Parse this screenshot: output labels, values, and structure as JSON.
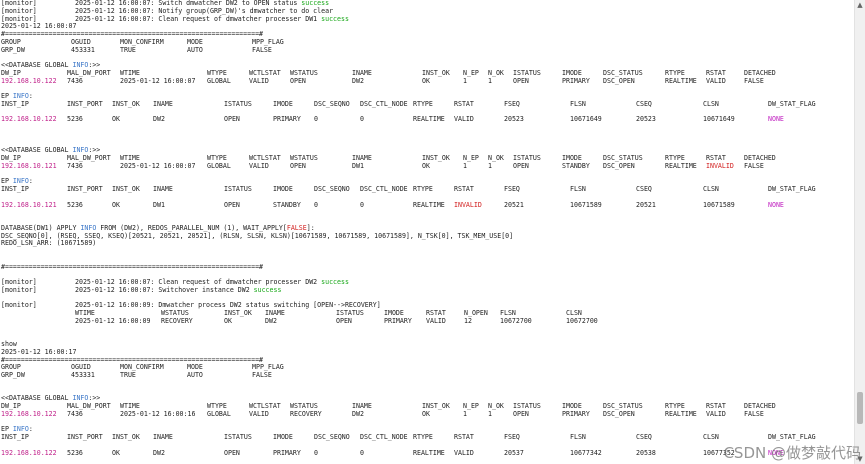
{
  "watermark": "CSDN @做梦敲代码",
  "colors": {
    "ip": "#c0208a",
    "keyword": "#3a76c8",
    "success": "#1aa81a",
    "invalid": "#d21f1f",
    "none": "#c020c0"
  },
  "lines": [
    [
      {
        "t": "[monitor]"
      },
      {
        "t": "2025-01-12 16:00:07: Switch dmwatcher DW2 to OPEN status "
      },
      {
        "t": "success",
        "cls": "ok"
      }
    ],
    [
      {
        "t": "[monitor]"
      },
      {
        "t": "2025-01-12 16:00:07: Notify group(GRP_DW)'s dmwatcher to do clear"
      }
    ],
    [
      {
        "t": "[monitor]"
      },
      {
        "t": "2025-01-12 16:00:07: Clean request of dmwatcher processer DW1 "
      },
      {
        "t": "success",
        "cls": "ok"
      }
    ],
    [
      {
        "t": "2025-01-12 16:00:07"
      }
    ],
    [
      {
        "t": "#================================================================#"
      }
    ],
    [
      {
        "t": "GROUP"
      },
      {
        "t": "OGUID"
      },
      {
        "t": "MON_CONFIRM"
      },
      {
        "t": "MODE"
      },
      {
        "t": "MPP_FLAG"
      }
    ],
    [
      {
        "t": "GRP_DW"
      },
      {
        "t": "453331"
      },
      {
        "t": "TRUE"
      },
      {
        "t": "AUTO"
      },
      {
        "t": "FALSE"
      }
    ],
    [],
    [
      {
        "t": "<<DATABASE GLOBAL "
      },
      {
        "t": "INFO",
        "cls": "kw"
      },
      {
        "t": ":>>"
      }
    ],
    [
      {
        "t": "DW_IP"
      },
      {
        "t": "MAL_DW_PORT"
      },
      {
        "t": "WTIME"
      },
      {
        "t": "WTYPE"
      },
      {
        "t": "WCTLSTAT"
      },
      {
        "t": "WSTATUS"
      },
      {
        "t": "INAME"
      },
      {
        "t": "INST_OK"
      },
      {
        "t": "N_EP"
      },
      {
        "t": "N_OK"
      },
      {
        "t": "ISTATUS"
      },
      {
        "t": "IMODE"
      },
      {
        "t": "DSC_STATUS"
      },
      {
        "t": "RTYPE"
      },
      {
        "t": "RSTAT"
      },
      {
        "t": "DETACHED"
      }
    ],
    [
      {
        "t": "192.168.10.122",
        "cls": "ip"
      },
      {
        "t": "7436"
      },
      {
        "t": "2025-01-12 16:00:07"
      },
      {
        "t": "GLOBAL"
      },
      {
        "t": "VALID"
      },
      {
        "t": "OPEN"
      },
      {
        "t": "DW2"
      },
      {
        "t": "OK"
      },
      {
        "t": "1"
      },
      {
        "t": "1"
      },
      {
        "t": "OPEN"
      },
      {
        "t": "PRIMARY"
      },
      {
        "t": "DSC_OPEN"
      },
      {
        "t": "REALTIME"
      },
      {
        "t": "VALID"
      },
      {
        "t": "FALSE"
      }
    ],
    [],
    [
      {
        "t": "EP "
      },
      {
        "t": "INFO",
        "cls": "kw"
      },
      {
        "t": ":"
      }
    ],
    [
      {
        "t": "INST_IP"
      },
      {
        "t": "INST_PORT"
      },
      {
        "t": "INST_OK"
      },
      {
        "t": "INAME"
      },
      {
        "t": "ISTATUS"
      },
      {
        "t": "IMODE"
      },
      {
        "t": "DSC_SEQNO"
      },
      {
        "t": "DSC_CTL_NODE"
      },
      {
        "t": "RTYPE"
      },
      {
        "t": "RSTAT"
      },
      {
        "t": "FSEQ"
      },
      {
        "t": "FLSN"
      },
      {
        "t": "CSEQ"
      },
      {
        "t": "CLSN"
      },
      {
        "t": "DW_STAT_FLAG"
      }
    ],
    [],
    [
      {
        "t": "192.168.10.122",
        "cls": "ip"
      },
      {
        "t": "5236"
      },
      {
        "t": "OK"
      },
      {
        "t": "DW2"
      },
      {
        "t": "OPEN"
      },
      {
        "t": "PRIMARY"
      },
      {
        "t": "0"
      },
      {
        "t": "0"
      },
      {
        "t": "REALTIME"
      },
      {
        "t": "VALID"
      },
      {
        "t": "20523"
      },
      {
        "t": "10671649"
      },
      {
        "t": "20523"
      },
      {
        "t": "10671649"
      },
      {
        "t": "NONE",
        "cls": "none"
      }
    ],
    [],
    [],
    [],
    [
      {
        "t": "<<DATABASE GLOBAL "
      },
      {
        "t": "INFO",
        "cls": "kw"
      },
      {
        "t": ":>>"
      }
    ],
    [
      {
        "t": "DW_IP"
      },
      {
        "t": "MAL_DW_PORT"
      },
      {
        "t": "WTIME"
      },
      {
        "t": "WTYPE"
      },
      {
        "t": "WCTLSTAT"
      },
      {
        "t": "WSTATUS"
      },
      {
        "t": "INAME"
      },
      {
        "t": "INST_OK"
      },
      {
        "t": "N_EP"
      },
      {
        "t": "N_OK"
      },
      {
        "t": "ISTATUS"
      },
      {
        "t": "IMODE"
      },
      {
        "t": "DSC_STATUS"
      },
      {
        "t": "RTYPE"
      },
      {
        "t": "RSTAT"
      },
      {
        "t": "DETACHED"
      }
    ],
    [
      {
        "t": "192.168.10.121",
        "cls": "ip"
      },
      {
        "t": "7436"
      },
      {
        "t": "2025-01-12 16:00:07"
      },
      {
        "t": "GLOBAL"
      },
      {
        "t": "VALID"
      },
      {
        "t": "OPEN"
      },
      {
        "t": "DW1"
      },
      {
        "t": "OK"
      },
      {
        "t": "1"
      },
      {
        "t": "1"
      },
      {
        "t": "OPEN"
      },
      {
        "t": "STANDBY"
      },
      {
        "t": "DSC_OPEN"
      },
      {
        "t": "REALTIME"
      },
      {
        "t": "INVALID",
        "cls": "bad"
      },
      {
        "t": "FALSE"
      }
    ],
    [],
    [
      {
        "t": "EP "
      },
      {
        "t": "INFO",
        "cls": "kw"
      },
      {
        "t": ":"
      }
    ],
    [
      {
        "t": "INST_IP"
      },
      {
        "t": "INST_PORT"
      },
      {
        "t": "INST_OK"
      },
      {
        "t": "INAME"
      },
      {
        "t": "ISTATUS"
      },
      {
        "t": "IMODE"
      },
      {
        "t": "DSC_SEQNO"
      },
      {
        "t": "DSC_CTL_NODE"
      },
      {
        "t": "RTYPE"
      },
      {
        "t": "RSTAT"
      },
      {
        "t": "FSEQ"
      },
      {
        "t": "FLSN"
      },
      {
        "t": "CSEQ"
      },
      {
        "t": "CLSN"
      },
      {
        "t": "DW_STAT_FLAG"
      }
    ],
    [],
    [
      {
        "t": "192.168.10.121",
        "cls": "ip"
      },
      {
        "t": "5236"
      },
      {
        "t": "OK"
      },
      {
        "t": "DW1"
      },
      {
        "t": "OPEN"
      },
      {
        "t": "STANDBY"
      },
      {
        "t": "0"
      },
      {
        "t": "0"
      },
      {
        "t": "REALTIME"
      },
      {
        "t": "INVALID",
        "cls": "bad"
      },
      {
        "t": "20521"
      },
      {
        "t": "10671589"
      },
      {
        "t": "20521"
      },
      {
        "t": "10671589"
      },
      {
        "t": "NONE",
        "cls": "none"
      }
    ],
    [],
    [],
    [
      {
        "t": "DATABASE(DW1) APPLY "
      },
      {
        "t": "INFO",
        "cls": "kw"
      },
      {
        "t": " FROM (DW2), REDOS_PARALLEL_NUM (1), WAIT_APPLY["
      },
      {
        "t": "FALSE",
        "cls": "bad"
      },
      {
        "t": "]:"
      }
    ],
    [
      {
        "t": "DSC_SEQNO[0], (RSEQ, SSEQ, KSEQ)[20521, 20521, 20521], (RLSN, SLSN, KLSN)[10671589, 10671589, 10671589], N_TSK[0], TSK_MEM_USE[0]"
      }
    ],
    [
      {
        "t": "REDO_LSN_ARR: (10671589)"
      }
    ],
    [],
    [],
    [
      {
        "t": "#================================================================#"
      }
    ],
    [],
    [
      {
        "t": "[monitor]"
      },
      {
        "t": "2025-01-12 16:00:07: Clean request of dmwatcher processer DW2 "
      },
      {
        "t": "success",
        "cls": "ok"
      }
    ],
    [
      {
        "t": "[monitor]"
      },
      {
        "t": "2025-01-12 16:00:07: Switchover instance DW2 "
      },
      {
        "t": "success",
        "cls": "ok"
      }
    ],
    [],
    [
      {
        "t": "[monitor]"
      },
      {
        "t": "2025-01-12 16:00:09: Dmwatcher process DW2 status switching [OPEN-->RECOVERY]"
      }
    ],
    [
      {
        "t": "WTIME"
      },
      {
        "t": "WSTATUS"
      },
      {
        "t": "INST_OK"
      },
      {
        "t": "INAME"
      },
      {
        "t": "ISTATUS"
      },
      {
        "t": "IMODE"
      },
      {
        "t": "RSTAT"
      },
      {
        "t": "N_OPEN"
      },
      {
        "t": "FLSN"
      },
      {
        "t": "CLSN"
      }
    ],
    [
      {
        "t": "2025-01-12 16:00:09"
      },
      {
        "t": "RECOVERY"
      },
      {
        "t": "OK"
      },
      {
        "t": "DW2"
      },
      {
        "t": "OPEN"
      },
      {
        "t": "PRIMARY"
      },
      {
        "t": "VALID"
      },
      {
        "t": "12"
      },
      {
        "t": "10672700"
      },
      {
        "t": "10672700"
      }
    ],
    [],
    [],
    [
      {
        "t": "show"
      }
    ],
    [
      {
        "t": "2025-01-12 16:00:17"
      }
    ],
    [
      {
        "t": "#================================================================#"
      }
    ],
    [
      {
        "t": "GROUP"
      },
      {
        "t": "OGUID"
      },
      {
        "t": "MON_CONFIRM"
      },
      {
        "t": "MODE"
      },
      {
        "t": "MPP_FLAG"
      }
    ],
    [
      {
        "t": "GRP_DW"
      },
      {
        "t": "453331"
      },
      {
        "t": "TRUE"
      },
      {
        "t": "AUTO"
      },
      {
        "t": "FALSE"
      }
    ],
    [],
    [],
    [
      {
        "t": "<<DATABASE GLOBAL "
      },
      {
        "t": "INFO",
        "cls": "kw"
      },
      {
        "t": ":>>"
      }
    ],
    [
      {
        "t": "DW_IP"
      },
      {
        "t": "MAL_DW_PORT"
      },
      {
        "t": "WTIME"
      },
      {
        "t": "WTYPE"
      },
      {
        "t": "WCTLSTAT"
      },
      {
        "t": "WSTATUS"
      },
      {
        "t": "INAME"
      },
      {
        "t": "INST_OK"
      },
      {
        "t": "N_EP"
      },
      {
        "t": "N_OK"
      },
      {
        "t": "ISTATUS"
      },
      {
        "t": "IMODE"
      },
      {
        "t": "DSC_STATUS"
      },
      {
        "t": "RTYPE"
      },
      {
        "t": "RSTAT"
      },
      {
        "t": "DETACHED"
      }
    ],
    [
      {
        "t": "192.168.10.122",
        "cls": "ip"
      },
      {
        "t": "7436"
      },
      {
        "t": "2025-01-12 16:00:16"
      },
      {
        "t": "GLOBAL"
      },
      {
        "t": "VALID"
      },
      {
        "t": "RECOVERY"
      },
      {
        "t": "DW2"
      },
      {
        "t": "OK"
      },
      {
        "t": "1"
      },
      {
        "t": "1"
      },
      {
        "t": "OPEN"
      },
      {
        "t": "PRIMARY"
      },
      {
        "t": "DSC_OPEN"
      },
      {
        "t": "REALTIME"
      },
      {
        "t": "VALID"
      },
      {
        "t": "FALSE"
      }
    ],
    [],
    [
      {
        "t": "EP "
      },
      {
        "t": "INFO",
        "cls": "kw"
      },
      {
        "t": ":"
      }
    ],
    [
      {
        "t": "INST_IP"
      },
      {
        "t": "INST_PORT"
      },
      {
        "t": "INST_OK"
      },
      {
        "t": "INAME"
      },
      {
        "t": "ISTATUS"
      },
      {
        "t": "IMODE"
      },
      {
        "t": "DSC_SEQNO"
      },
      {
        "t": "DSC_CTL_NODE"
      },
      {
        "t": "RTYPE"
      },
      {
        "t": "RSTAT"
      },
      {
        "t": "FSEQ"
      },
      {
        "t": "FLSN"
      },
      {
        "t": "CSEQ"
      },
      {
        "t": "CLSN"
      },
      {
        "t": "DW_STAT_FLAG"
      }
    ],
    [],
    [
      {
        "t": "192.168.10.122",
        "cls": "ip"
      },
      {
        "t": "5236"
      },
      {
        "t": "OK"
      },
      {
        "t": "DW2"
      },
      {
        "t": "OPEN"
      },
      {
        "t": "PRIMARY"
      },
      {
        "t": "0"
      },
      {
        "t": "0"
      },
      {
        "t": "REALTIME"
      },
      {
        "t": "VALID"
      },
      {
        "t": "20537"
      },
      {
        "t": "10677342"
      },
      {
        "t": "20538"
      },
      {
        "t": "10677352"
      },
      {
        "t": "NONE",
        "cls": "none"
      }
    ]
  ]
}
